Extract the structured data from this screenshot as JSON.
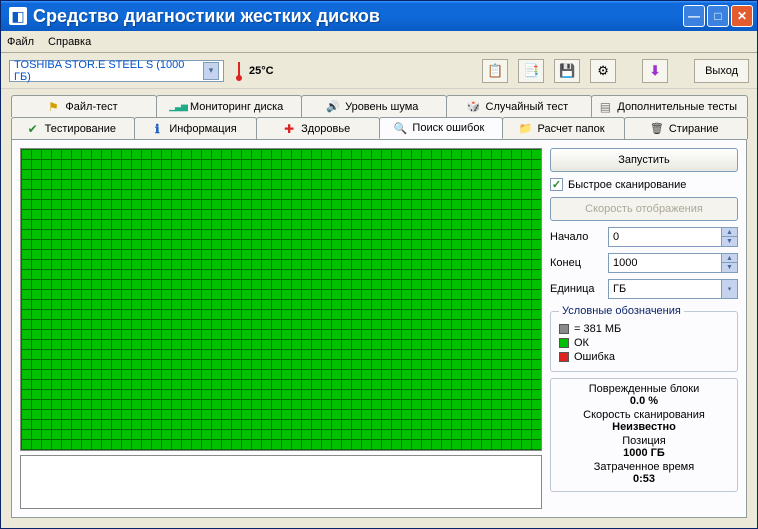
{
  "window": {
    "title": "Средство диагностики жестких дисков"
  },
  "menu": {
    "file": "Файл",
    "help": "Справка"
  },
  "toolbar": {
    "drive": "TOSHIBA STOR.E STEEL S  (1000 ГБ)",
    "temperature": "25°C",
    "exit": "Выход"
  },
  "tabs": {
    "file_test": "Файл-тест",
    "monitoring": "Мониторинг диска",
    "noise": "Уровень шума",
    "random": "Случайный тест",
    "extra": "Дополнительные тесты",
    "testing": "Тестирование",
    "info": "Информация",
    "health": "Здоровье",
    "errors": "Поиск ошибок",
    "folders": "Расчет папок",
    "erase": "Стирание"
  },
  "controls": {
    "start": "Запустить",
    "quick_scan": "Быстрое сканирование",
    "render_speed": "Скорость отображения",
    "start_label": "Начало",
    "start_value": "0",
    "end_label": "Конец",
    "end_value": "1000",
    "unit_label": "Единица",
    "unit_value": "ГБ"
  },
  "legend": {
    "title": "Условные обозначения",
    "block": "= 381 МБ",
    "ok": "ОК",
    "error": "Ошибка"
  },
  "stats": {
    "damaged_label": "Поврежденные блоки",
    "damaged_value": "0.0 %",
    "speed_label": "Скорость сканирования",
    "speed_value": "Неизвестно",
    "position_label": "Позиция",
    "position_value": "1000 ГБ",
    "elapsed_label": "Затраченное время",
    "elapsed_value": "0:53"
  }
}
